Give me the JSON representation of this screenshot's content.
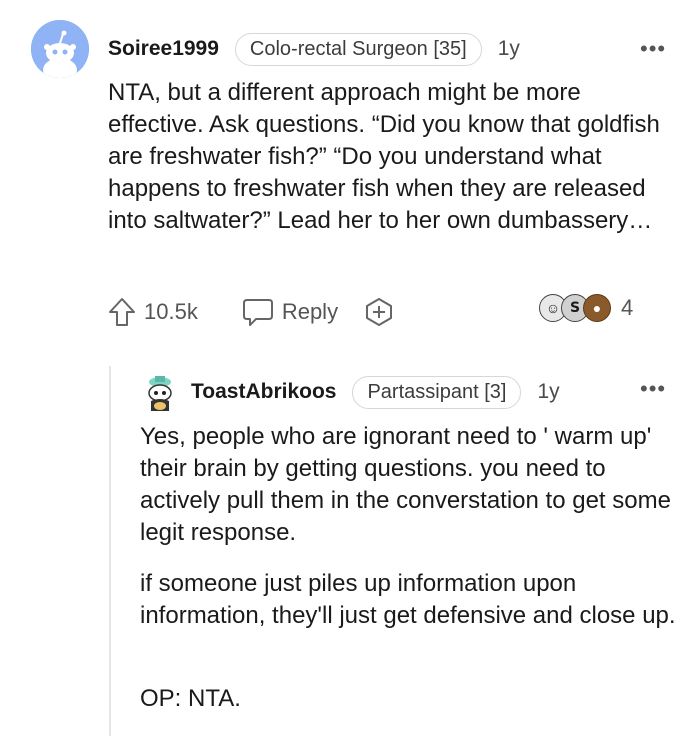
{
  "comment": {
    "author": "Soiree1999",
    "flair": "Colo-rectal Surgeon [35]",
    "age": "1y",
    "body": "NTA, but a different approach might be more effective. Ask questions. “Did you know that goldfish are freshwater fish?” “Do you understand what happens to freshwater fish when they are released into saltwater?” Lead her to her own dumbassery…",
    "upvotes": "10.5k",
    "reply_label": "Reply",
    "awards_count": "4",
    "icons": {
      "avatar": "reddit-snoo-avatar",
      "upvote": "upvote-arrow-icon",
      "reply": "speech-bubble-icon",
      "award": "add-award-icon",
      "more": "more-options-icon"
    }
  },
  "reply": {
    "author": "ToastAbrikoos",
    "flair": "Partassipant [3]",
    "age": "1y",
    "paragraphs": [
      "Yes, people who are ignorant need to ' warm up' their brain by getting questions. you need to actively pull them in the converstation to get some legit response.",
      "if someone just piles up information upon information, they'll just get defensive and close up.",
      "OP: NTA."
    ],
    "icons": {
      "avatar": "custom-snoo-avatar",
      "more": "more-options-icon"
    }
  },
  "more_glyph": "•••",
  "awards": [
    "laughing-award",
    "silver-award",
    "bear-award"
  ],
  "award_glyphs": [
    "☺",
    "S",
    "●"
  ],
  "colors": {
    "avatar_bg": "#8fb3f5",
    "text": "#1a1a1b",
    "muted": "#555555",
    "flair_border": "#d7d7d7"
  }
}
